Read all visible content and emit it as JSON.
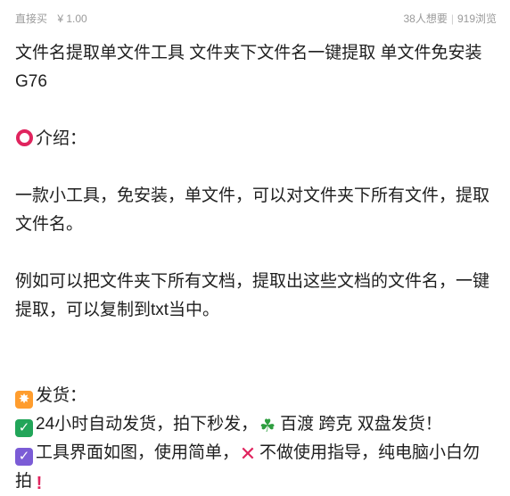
{
  "header": {
    "buy_label": "直接买",
    "original_price": "¥ 1.00",
    "want_count": "38人想要",
    "view_count": "919浏览",
    "separator": "|"
  },
  "post": {
    "title": "文件名提取单文件工具 文件夹下文件名一键提取 单文件免安装G76",
    "intro_heading": "介绍：",
    "intro_p1": "一款小工具，免安装，单文件，可以对文件夹下所有文件，提取文件名。",
    "intro_p2": "例如可以把文件夹下所有文档，提取出这些文档的文件名，一键提取，可以复制到txt当中。",
    "shipping_heading": "发货：",
    "shipping_line1_a": "24小时自动发货，拍下秒发，",
    "shipping_line1_b": "百渡 跨克 双盘发货！",
    "shipping_line2_a": "工具界面如图，使用简单，",
    "shipping_line2_b": "不做使用指导，纯电脑小白勿拍"
  },
  "icons": {
    "ring": "hollow-red-circle-icon",
    "burst": "eight-pointed-star-icon",
    "check_green": "check-mark-button-icon",
    "clover": "shamrock-icon",
    "check_purple": "ballot-box-check-icon",
    "cross": "cross-mark-icon",
    "exclaim": "exclamation-mark-icon"
  },
  "colors": {
    "price_accent": "#ff5000",
    "meta_text": "#9a9a9a",
    "body_text": "#1f1f1f",
    "emoji_red": "#e0245e",
    "emoji_orange": "#ff9d2e",
    "emoji_green": "#22a559",
    "emoji_purple": "#7b5cd6"
  }
}
